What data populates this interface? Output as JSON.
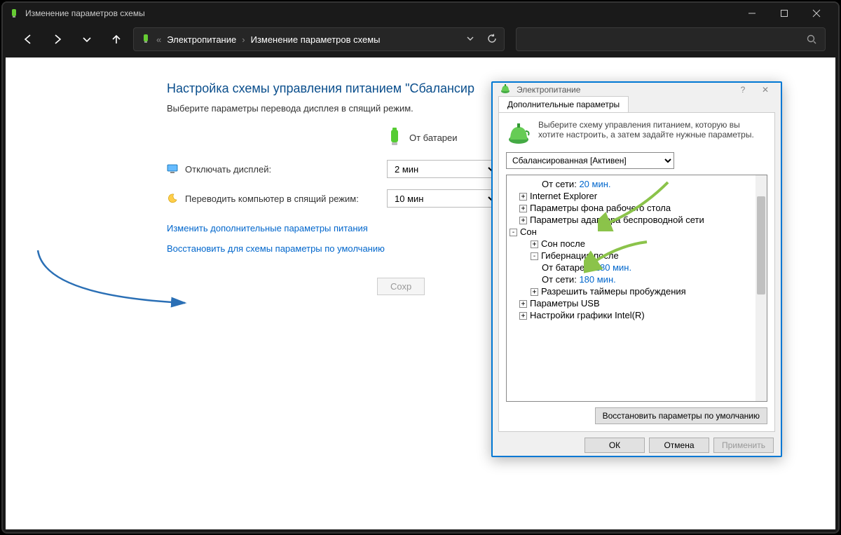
{
  "titlebar": {
    "title": "Изменение параметров схемы"
  },
  "addrbar": {
    "crumb1": "Электропитание",
    "crumb2": "Изменение параметров схемы"
  },
  "panel": {
    "heading": "Настройка схемы управления питанием \"Сбалансир",
    "sub": "Выберите параметры перевода дисплея в спящий режим.",
    "col_battery": "От батареи",
    "row_display": "Отключать дисплей:",
    "val_display": "2 мин",
    "row_sleep": "Переводить компьютер в спящий режим:",
    "val_sleep": "10 мин",
    "link_advanced": "Изменить дополнительные параметры питания",
    "link_restore": "Восстановить для схемы параметры по умолчанию",
    "btn_save": "Сохр"
  },
  "dialog": {
    "title": "Электропитание",
    "tab": "Дополнительные параметры",
    "desc": "Выберите схему управления питанием, которую вы хотите настроить, а затем задайте нужные параметры.",
    "scheme": "Сбалансированная [Активен]",
    "tree": {
      "n_fromnet_lbl": "От сети:",
      "n_fromnet_val": "20 мин.",
      "n_ie": "Internet Explorer",
      "n_bg": "Параметры фона рабочего стола",
      "n_wifi": "Параметры адаптера беспроводной сети",
      "n_sleep": "Сон",
      "n_sleep_after": "Сон после",
      "n_hib": "Гибернация после",
      "n_hib_bat_lbl": "От батареи:",
      "n_hib_bat_val": "180 мин.",
      "n_hib_net_lbl": "От сети:",
      "n_hib_net_val": "180 мин.",
      "n_wake": "Разрешить таймеры пробуждения",
      "n_usb": "Параметры USB",
      "n_intel": "Настройки графики Intel(R)"
    },
    "btn_restore": "Восстановить параметры по умолчанию",
    "btn_ok": "ОК",
    "btn_cancel": "Отмена",
    "btn_apply": "Применить"
  }
}
